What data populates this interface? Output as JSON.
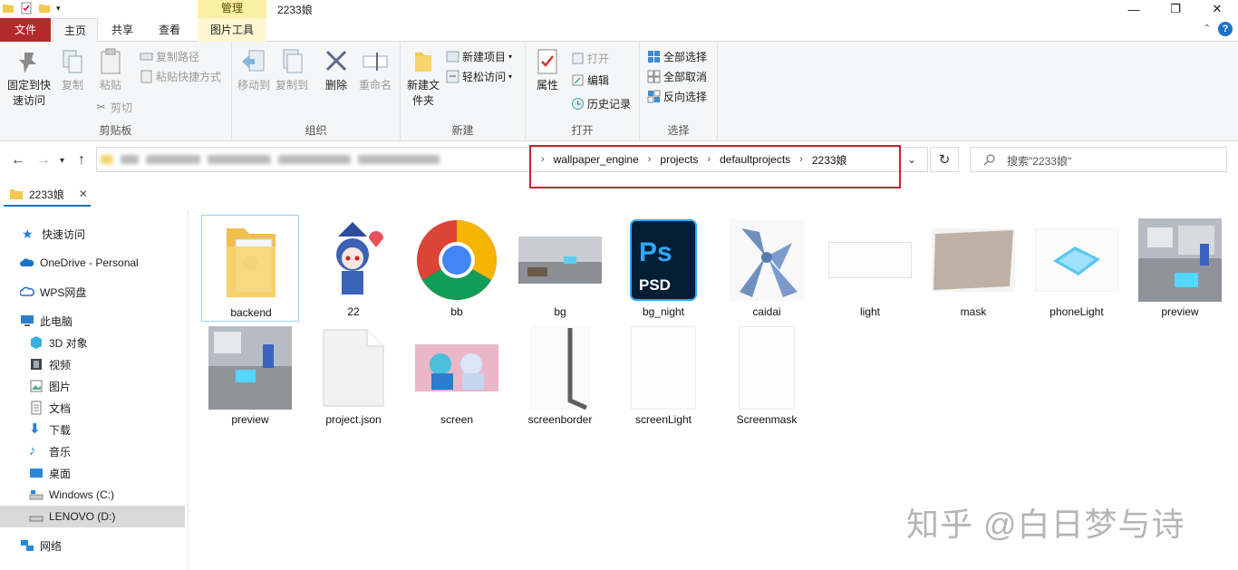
{
  "titlebar": {
    "context_tab": "管理",
    "title": "2233娘"
  },
  "ribbon_tabs": {
    "file": "文件",
    "home": "主页",
    "share": "共享",
    "view": "查看",
    "picture_tools": "图片工具"
  },
  "clipboard": {
    "pin": "固定到快速访问",
    "copy": "复制",
    "paste": "粘贴",
    "copy_path": "复制路径",
    "paste_shortcut": "粘贴快捷方式",
    "cut": "剪切",
    "group_label": "剪贴板"
  },
  "organize": {
    "move_to": "移动到",
    "copy_to": "复制到",
    "delete": "删除",
    "rename": "重命名",
    "group_label": "组织"
  },
  "new": {
    "new_folder": "新建文件夹",
    "new_item": "新建项目",
    "easy_access": "轻松访问",
    "group_label": "新建"
  },
  "open": {
    "properties": "属性",
    "open": "打开",
    "edit": "编辑",
    "history": "历史记录",
    "group_label": "打开"
  },
  "select": {
    "select_all": "全部选择",
    "select_none": "全部取消",
    "invert": "反向选择",
    "group_label": "选择"
  },
  "address": {
    "crumbs": [
      "wallpaper_engine",
      "projects",
      "defaultprojects",
      "2233娘"
    ],
    "search_placeholder": "搜索\"2233娘\""
  },
  "folder_tab": {
    "label": "2233娘"
  },
  "nav": {
    "quick_access": "快速访问",
    "onedrive": "OneDrive - Personal",
    "wps": "WPS网盘",
    "this_pc": "此电脑",
    "objects3d": "3D 对象",
    "videos": "视频",
    "pictures": "图片",
    "documents": "文档",
    "downloads": "下载",
    "music": "音乐",
    "desktop": "桌面",
    "drive_c": "Windows (C:)",
    "drive_d": "LENOVO (D:)",
    "network": "网络"
  },
  "files": [
    {
      "name": "backend"
    },
    {
      "name": "22"
    },
    {
      "name": "bb"
    },
    {
      "name": "bg"
    },
    {
      "name": "bg_night"
    },
    {
      "name": "caidai"
    },
    {
      "name": "light"
    },
    {
      "name": "mask"
    },
    {
      "name": "phoneLight"
    },
    {
      "name": "preview"
    },
    {
      "name": "preview"
    },
    {
      "name": "project.json"
    },
    {
      "name": "screen"
    },
    {
      "name": "screenborder"
    },
    {
      "name": "screenLight"
    },
    {
      "name": "Screenmask"
    }
  ],
  "watermark": "知乎 @白日梦与诗",
  "colors": {
    "file_tab": "#b32a2a",
    "accent": "#1a73c9",
    "highlight": "#c8232c",
    "context_tab": "#fbf0a6"
  }
}
